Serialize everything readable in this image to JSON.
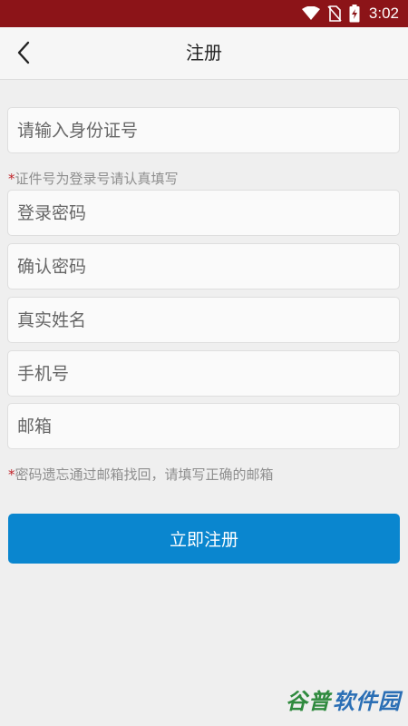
{
  "status_bar": {
    "time": "3:02",
    "icons": [
      "wifi-icon",
      "no-sim-icon",
      "battery-charging-icon"
    ]
  },
  "header": {
    "title": "注册",
    "back_icon": "chevron-left-icon"
  },
  "form": {
    "id_placeholder": "请输入身份证号",
    "id_hint_star": "*",
    "id_hint": "证件号为登录号请认真填写",
    "password_placeholder": "登录密码",
    "confirm_placeholder": "确认密码",
    "name_placeholder": "真实姓名",
    "phone_placeholder": "手机号",
    "email_placeholder": "邮箱",
    "email_hint_star": "*",
    "email_hint": "密码遗忘通过邮箱找回，请填写正确的邮箱",
    "submit_label": "立即注册"
  },
  "watermark": {
    "part1": "谷普",
    "part2": "软件园"
  },
  "colors": {
    "status_bar": "#8c1418",
    "button": "#0a86cf",
    "hint_star": "#c0242a"
  }
}
